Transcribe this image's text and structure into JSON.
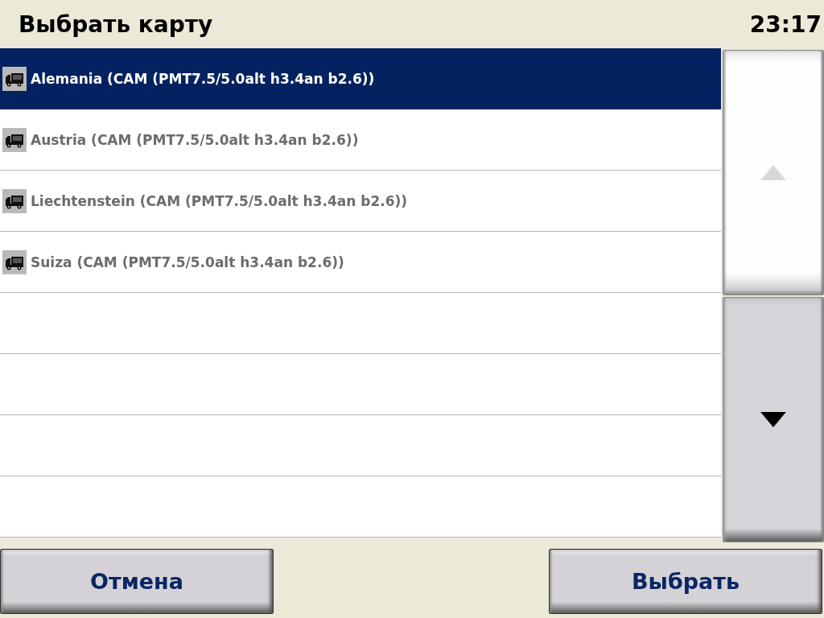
{
  "header": {
    "title": "Выбрать карту",
    "clock": "23:17"
  },
  "maps": [
    {
      "name": "Alemania (CAM (PMT7.5/5.0alt h3.4an b2.6))",
      "selected": true
    },
    {
      "name": "Austria (CAM (PMT7.5/5.0alt h3.4an b2.6))",
      "selected": false
    },
    {
      "name": "Liechtenstein (CAM (PMT7.5/5.0alt h3.4an b2.6))",
      "selected": false
    },
    {
      "name": "Suiza (CAM (PMT7.5/5.0alt h3.4an b2.6))",
      "selected": false
    }
  ],
  "scroll_buttons": [
    {
      "kind": "up",
      "disabled": true
    },
    {
      "kind": "down",
      "disabled": false
    }
  ],
  "buttons": [
    {
      "label": "Отмена"
    },
    {
      "label": "Выбрать"
    }
  ]
}
